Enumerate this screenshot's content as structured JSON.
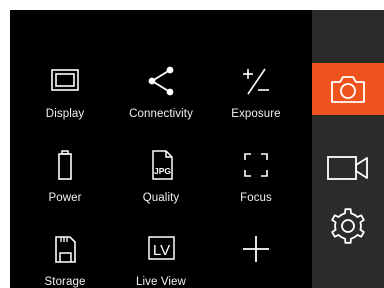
{
  "colors": {
    "background": "#000000",
    "sidebar": "#2b2b2b",
    "accent": "#f0541e",
    "foreground": "#ffffff"
  },
  "menu": {
    "items": [
      {
        "label": "Display",
        "icon": "display-icon"
      },
      {
        "label": "Connectivity",
        "icon": "share-icon"
      },
      {
        "label": "Exposure",
        "icon": "exposure-icon"
      },
      {
        "label": "Power",
        "icon": "battery-icon"
      },
      {
        "label": "Quality",
        "icon": "jpg-file-icon",
        "badge": "JPG"
      },
      {
        "label": "Focus",
        "icon": "focus-frame-icon"
      },
      {
        "label": "Storage",
        "icon": "sd-card-icon"
      },
      {
        "label": "Live View",
        "icon": "live-view-icon",
        "badge": "LV"
      },
      {
        "label": "",
        "icon": "plus-icon"
      }
    ]
  },
  "sidebar": {
    "buttons": [
      {
        "name": "photo-mode",
        "icon": "camera-icon",
        "active": true
      },
      {
        "name": "video-mode",
        "icon": "video-camera-icon",
        "active": false
      },
      {
        "name": "settings",
        "icon": "gear-icon",
        "active": false
      }
    ]
  }
}
